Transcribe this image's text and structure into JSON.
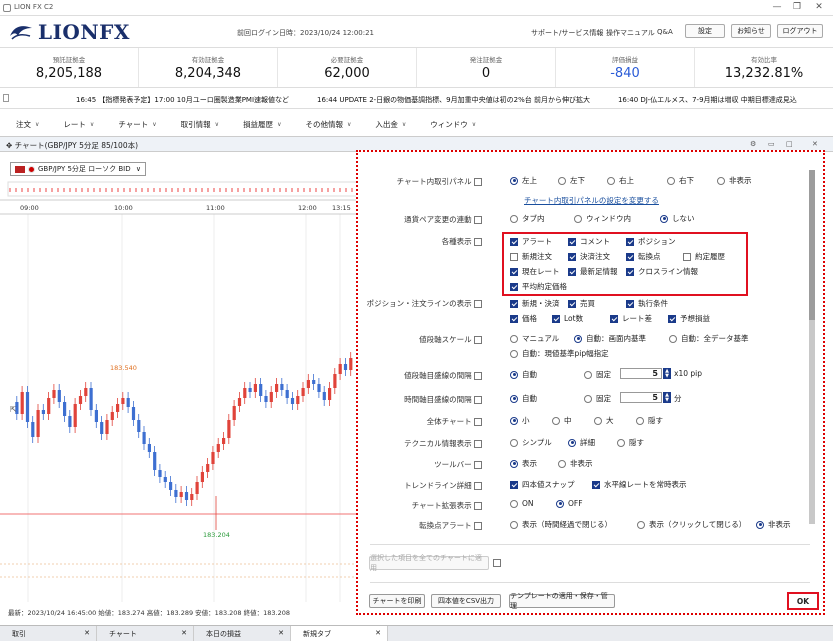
{
  "window": {
    "title": "LION FX C2"
  },
  "header": {
    "logo": "LIONFX",
    "login": "前回ログイン日時：2023/10/24 12:00:21",
    "links": [
      "サポート/サービス情報",
      "操作マニュアル",
      "Q&A"
    ],
    "buttons": [
      "設定",
      "お知らせ",
      "ログアウト"
    ]
  },
  "summary": [
    {
      "label": "預託証拠金",
      "value": "8,205,188"
    },
    {
      "label": "有効証拠金",
      "value": "8,204,348"
    },
    {
      "label": "必要証拠金",
      "value": "62,000"
    },
    {
      "label": "発注証拠金",
      "value": "0"
    },
    {
      "label": "評価損益",
      "value": "-840"
    },
    {
      "label": "有効比率",
      "value": "13,232.81%"
    }
  ],
  "ticker": "16:45 【指標発表予定】17:00 10月ユーロ圏製造業PMI速報値など　　　　16:44 UPDATE 2-日銀の物価基調指標、9月加重中央値は初の2%台 前月から伸び拡大　　　　16:40 DJ-仏エルメス、7-9月期は増収 中期目標達成見込",
  "menu": [
    "注文",
    "レート",
    "チャート",
    "取引情報",
    "損益履歴",
    "その他情報",
    "入出金",
    "ウィンドウ"
  ],
  "chart": {
    "title": "チャート(GBP/JPY 5分足 85/100本)",
    "pair": "GBP/JPY 5分足 ローソク BID",
    "times": [
      "09:00",
      "10:00",
      "11:00",
      "12:00",
      "13:15"
    ],
    "high_label": "183.540",
    "low_label": "183.204",
    "status": "最新：2023/10/24 16:45:00 始値：183.274 高値：183.289 安値：183.208 終値：183.208",
    "colors": {
      "up": "#e0433a",
      "down": "#3d6fd1"
    }
  },
  "tabs": [
    "取引",
    "チャート",
    "本日の損益",
    "新規タブ"
  ],
  "panel": {
    "rows": {
      "panel_pos": {
        "label": "チャート内取引パネル",
        "options": [
          "左上",
          "左下",
          "右上",
          "右下",
          "非表示"
        ],
        "selected": 0
      },
      "panel_link": "チャート内取引パネルの設定を変更する",
      "sync": {
        "label": "通貨ペア変更の連動",
        "options": [
          "タブ内",
          "ウィンドウ内",
          "しない"
        ],
        "selected": 2
      },
      "display": {
        "label": "各種表示",
        "items": [
          {
            "t": "アラート",
            "on": true
          },
          {
            "t": "コメント",
            "on": true
          },
          {
            "t": "ポジション",
            "on": true
          },
          {
            "t": "新規注文",
            "on": false
          },
          {
            "t": "決済注文",
            "on": true
          },
          {
            "t": "転換点",
            "on": true
          },
          {
            "t": "約定履歴",
            "on": false
          },
          {
            "t": "現在レート",
            "on": true
          },
          {
            "t": "最新足情報",
            "on": true
          },
          {
            "t": "クロスライン情報",
            "on": true
          },
          {
            "t": "平均約定価格",
            "on": true
          }
        ]
      },
      "posline": {
        "label": "ポジション・注文ラインの表示",
        "items": [
          {
            "t": "新規・決済",
            "on": true
          },
          {
            "t": "売買",
            "on": true
          },
          {
            "t": "執行条件",
            "on": true
          },
          {
            "t": "価格",
            "on": true
          },
          {
            "t": "Lot数",
            "on": true
          },
          {
            "t": "レート差",
            "on": true
          },
          {
            "t": "予想損益",
            "on": true
          }
        ]
      },
      "scale": {
        "label": "値段軸スケール",
        "options": [
          "マニュアル",
          "自動：画面内基準",
          "自動：全データ基準",
          "自動：現値基準pip幅指定"
        ],
        "selected": 1
      },
      "vgrid": {
        "label": "値段軸目盛線の間隔",
        "options": [
          "自動",
          "固定"
        ],
        "selected": 0,
        "value": "5",
        "unit": "x10 pip"
      },
      "tgrid": {
        "label": "時間軸目盛線の間隔",
        "options": [
          "自動",
          "固定"
        ],
        "selected": 0,
        "value": "5",
        "unit": "分"
      },
      "whole": {
        "label": "全体チャート",
        "options": [
          "小",
          "中",
          "大",
          "隠す"
        ],
        "selected": 0
      },
      "tech": {
        "label": "テクニカル情報表示",
        "options": [
          "シンプル",
          "詳細",
          "隠す"
        ],
        "selected": 1
      },
      "tool": {
        "label": "ツールバー",
        "options": [
          "表示",
          "非表示"
        ],
        "selected": 0
      },
      "trend": {
        "label": "トレンドライン詳細",
        "items": [
          {
            "t": "四本値スナップ",
            "on": true
          },
          {
            "t": "水平線レートを常時表示",
            "on": true
          }
        ]
      },
      "ext": {
        "label": "チャート拡張表示",
        "options": [
          "ON",
          "OFF"
        ],
        "selected": 1
      },
      "alert": {
        "label": "転換点アラート",
        "options": [
          "表示（時間経過で閉じる）",
          "表示（クリックして閉じる）",
          "非表示"
        ],
        "selected": 2
      }
    },
    "apply_all": "選択した項目を全てのチャートに適用",
    "buttons": [
      "チャートを印刷",
      "四本値をCSV出力",
      "テンプレートの適用・保存・管理"
    ],
    "ok": "OK"
  }
}
